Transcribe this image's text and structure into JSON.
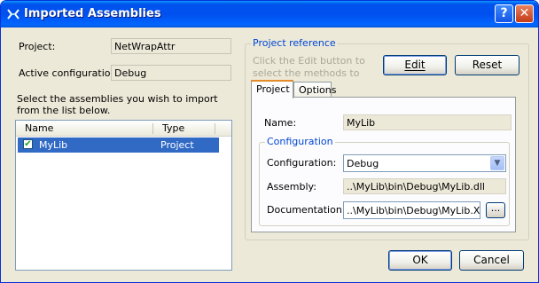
{
  "window": {
    "title": "Imported Assemblies",
    "help_glyph": "?",
    "close_glyph": "✕"
  },
  "project": {
    "label": "Project:",
    "value": "NetWrapAttr"
  },
  "active_config": {
    "label": "Active configuration:",
    "value": "Debug"
  },
  "instructions": "Select the assemblies you wish to import from the list below.",
  "list": {
    "columns": [
      "Name",
      "Type"
    ],
    "rows": [
      {
        "name": "MyLib",
        "type": "Project",
        "checked": true
      }
    ]
  },
  "project_reference": {
    "title": "Project reference",
    "hint": "Click the Edit button to select the methods to import.",
    "edit_label": "Edit",
    "reset_label": "Reset"
  },
  "tabs": [
    {
      "label": "Project",
      "active": true
    },
    {
      "label": "Options",
      "active": false
    }
  ],
  "project_tab": {
    "name_label": "Name:",
    "name_value": "MyLib",
    "configuration_group_title": "Configuration",
    "configuration_label": "Configuration:",
    "configuration_value": "Debug",
    "assembly_label": "Assembly:",
    "assembly_value": "..\\MyLib\\bin\\Debug\\MyLib.dll",
    "documentation_label": "Documentation:",
    "documentation_value": "..\\MyLib\\bin\\Debug\\MyLib.XML",
    "browse_label": "..."
  },
  "footer": {
    "ok_label": "OK",
    "cancel_label": "Cancel"
  },
  "colors": {
    "titlebar": "#0054e3",
    "selection": "#316ac5",
    "group_title": "#0046d5"
  }
}
